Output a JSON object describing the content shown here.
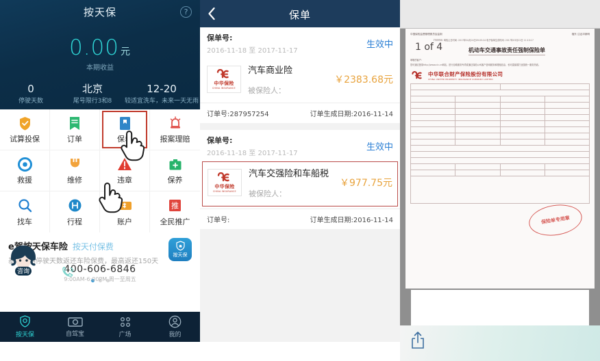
{
  "panel1": {
    "header": {
      "title": "按天保",
      "help_icon": "question-circle-icon",
      "amount": "0.00",
      "amount_unit": "元",
      "amount_label": "本期收益",
      "stats": [
        {
          "value": "0",
          "label": "停驶天数"
        },
        {
          "value": "北京",
          "label": "尾号限行3和8"
        },
        {
          "value": "12-20",
          "label": "较适宜洗车，未来一天无雨"
        }
      ]
    },
    "grid": [
      {
        "label": "试算投保",
        "icon": "shield-check-icon",
        "color": "#f0a429",
        "selected": false
      },
      {
        "label": "订单",
        "icon": "list-bookmark-icon",
        "color": "#2eb872",
        "selected": false
      },
      {
        "label": "保单",
        "icon": "policy-document-icon",
        "color": "#2f86c8",
        "selected": true
      },
      {
        "label": "报案理赔",
        "icon": "alarm-light-icon",
        "color": "#e0534d",
        "selected": false
      },
      {
        "label": "救援",
        "icon": "lifebuoy-icon",
        "color": "#1f8fd6",
        "selected": false
      },
      {
        "label": "维修",
        "icon": "wrench-icon",
        "color": "#f2a33c",
        "selected": false
      },
      {
        "label": "违章",
        "icon": "warning-triangle-icon",
        "color": "#e03c31",
        "selected": false
      },
      {
        "label": "保养",
        "icon": "toolbox-icon",
        "color": "#27b36b",
        "selected": false
      },
      {
        "label": "找车",
        "icon": "search-icon",
        "color": "#1f7fd0",
        "selected": false
      },
      {
        "label": "行程",
        "icon": "route-icon",
        "color": "#1f88c9",
        "selected": false
      },
      {
        "label": "账户",
        "icon": "wallet-dollar-icon",
        "color": "#f0a02b",
        "selected": false
      },
      {
        "label": "全民推广",
        "icon": "promote-icon",
        "color": "#e0443c",
        "selected": false
      }
    ],
    "promo": {
      "title": "e驾按天保车险",
      "subtitle_accent": "按天付保费",
      "description": "基于车辆停驶天数返还车险保费，最高返还150天",
      "badge_label": "按天保",
      "badge_icon": "shield-car-icon",
      "dots": 3,
      "active_dot": 0
    },
    "consult": {
      "label": "咨询",
      "icon": "headset-avatar-icon"
    },
    "phone": {
      "number": "400-606-6846",
      "hours": "9:00AM-6:00PM 周一至周五",
      "icon": "phone-ring-icon"
    },
    "tabbar": [
      {
        "label": "按天保",
        "icon": "shield-location-icon",
        "active": true
      },
      {
        "label": "自驾宝",
        "icon": "dashcam-icon",
        "active": false
      },
      {
        "label": "广场",
        "icon": "grid-dots-icon",
        "active": false
      },
      {
        "label": "我的",
        "icon": "user-circle-icon",
        "active": false
      }
    ]
  },
  "panel2": {
    "nav": {
      "title": "保单",
      "back_icon": "chevron-left-icon"
    },
    "policies": [
      {
        "policy_no_label": "保单号:",
        "date_range": "2016-11-18 至 2017-11-17",
        "status": "生效中",
        "insurer": {
          "cn": "中华保险",
          "en": "CHINA INSURANCE",
          "logo_icon": "china-insurance-logo"
        },
        "product": "汽车商业险",
        "insured_label": "被保险人：",
        "price": "￥2383.68元",
        "order_no": "订单号:287957254",
        "order_date": "订单生成日期:2016-11-14",
        "highlighted": false
      },
      {
        "policy_no_label": "保单号:",
        "date_range": "2016-11-18 至 2017-11-17",
        "status": "生效中",
        "insurer": {
          "cn": "中华保险",
          "en": "CHINA INSURANCE",
          "logo_icon": "china-insurance-logo"
        },
        "product": "汽车交强险和车船税",
        "insured_label": "被保险人：",
        "price": "￥977.75元",
        "order_no": "订单号:",
        "order_date": "订单生成日期:2016-11-14",
        "highlighted": true
      }
    ]
  },
  "panel3": {
    "page_badge": "1 of 4",
    "document": {
      "regulator": "中国保险监督管理委员会监制",
      "top_right": "福东 注证冲销明",
      "meta": "打印时间: 保险止日时间: 2017年04月24日09:05:24 电子保单生成时间: 2017年03月22日 11:10:17",
      "title": "机动车交通事故责任强制保险单",
      "note_head": "尊敬的客户：",
      "note_body": "您可通过登录http://www.cic.cn网站，进行自助服务专项或通过保险公司客户咨询服务和理赔信息，也可直接拨打全国统一服务热线。",
      "brand_cn": "中华联合财产保险股份有限公司",
      "brand_en": "CHINA UNITED PROPERTY INSURANCE COMPANY LIMITED",
      "stamp_text": "保险单专用章"
    },
    "share_icon": "share-up-icon"
  }
}
